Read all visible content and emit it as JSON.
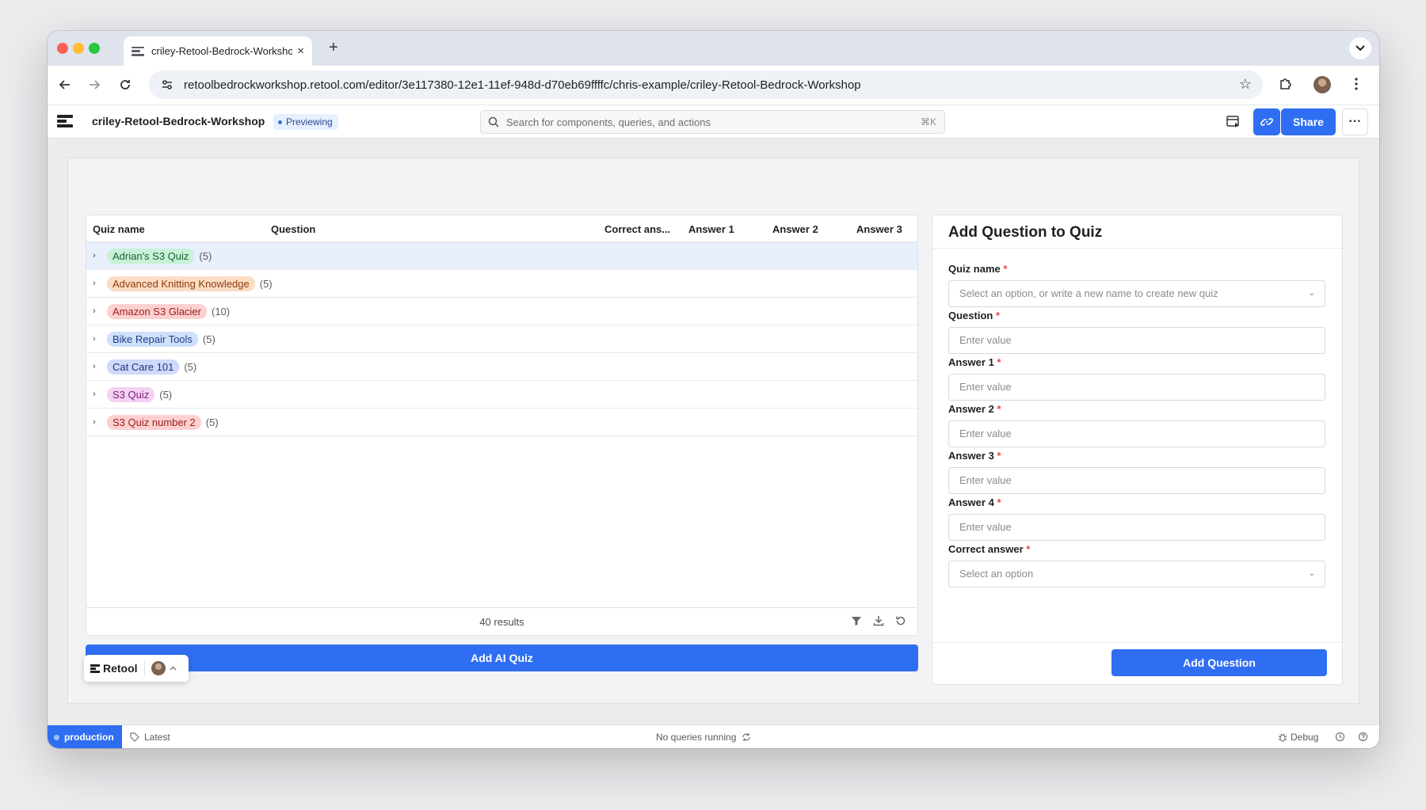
{
  "browser": {
    "tab_title": "criley-Retool-Bedrock-Workshop",
    "url": "retoolbedrockworkshop.retool.com/editor/3e117380-12e1-11ef-948d-d70eb69ffffc/chris-example/criley-Retool-Bedrock-Workshop",
    "new_tab": "+",
    "close": "×"
  },
  "app_header": {
    "title": "criley-Retool-Bedrock-Workshop",
    "mode_badge": "Previewing",
    "search_placeholder": "Search for components, queries, and actions",
    "search_shortcut": "⌘K",
    "share_label": "Share",
    "more": "···"
  },
  "table": {
    "columns": [
      "Quiz name",
      "Question",
      "Correct ans...",
      "Answer 1",
      "Answer 2",
      "Answer 3"
    ],
    "groups": [
      {
        "name": "Adrian's S3 Quiz",
        "count": "(5)",
        "bg": "#c8f1d6",
        "fg": "#17643a"
      },
      {
        "name": "Advanced Knitting Knowledge",
        "count": "(5)",
        "bg": "#fddcc4",
        "fg": "#8a3d0f"
      },
      {
        "name": "Amazon S3 Glacier",
        "count": "(10)",
        "bg": "#fdd0d0",
        "fg": "#9b1c1c"
      },
      {
        "name": "Bike Repair Tools",
        "count": "(5)",
        "bg": "#cfe0fb",
        "fg": "#1d3f86"
      },
      {
        "name": "Cat Care 101",
        "count": "(5)",
        "bg": "#cfd9fa",
        "fg": "#1f347e"
      },
      {
        "name": "S3 Quiz",
        "count": "(5)",
        "bg": "#f4d2f3",
        "fg": "#7a1f78"
      },
      {
        "name": "S3 Quiz number 2",
        "count": "(5)",
        "bg": "#fdd0d0",
        "fg": "#9b1c1c"
      }
    ],
    "results": "40 results"
  },
  "add_ai_quiz_label": "Add AI Quiz",
  "retool_pill_label": "Retool",
  "form": {
    "title": "Add Question to Quiz",
    "required_mark": "*",
    "fields": [
      {
        "label": "Quiz name",
        "placeholder": "Select an option, or write a new name to create new quiz",
        "dropdown": true
      },
      {
        "label": "Question",
        "placeholder": "Enter value",
        "dropdown": false
      },
      {
        "label": "Answer 1",
        "placeholder": "Enter value",
        "dropdown": false
      },
      {
        "label": "Answer 2",
        "placeholder": "Enter value",
        "dropdown": false
      },
      {
        "label": "Answer 3",
        "placeholder": "Enter value",
        "dropdown": false
      },
      {
        "label": "Answer 4",
        "placeholder": "Enter value",
        "dropdown": false
      },
      {
        "label": "Correct answer",
        "placeholder": "Select an option",
        "dropdown": true
      }
    ],
    "submit_label": "Add Question"
  },
  "status_bar": {
    "environment": "production",
    "version": "Latest",
    "queries": "No queries running",
    "debug": "Debug"
  },
  "colors": {
    "accent": "#2f6ef2",
    "required": "#e5484d"
  }
}
